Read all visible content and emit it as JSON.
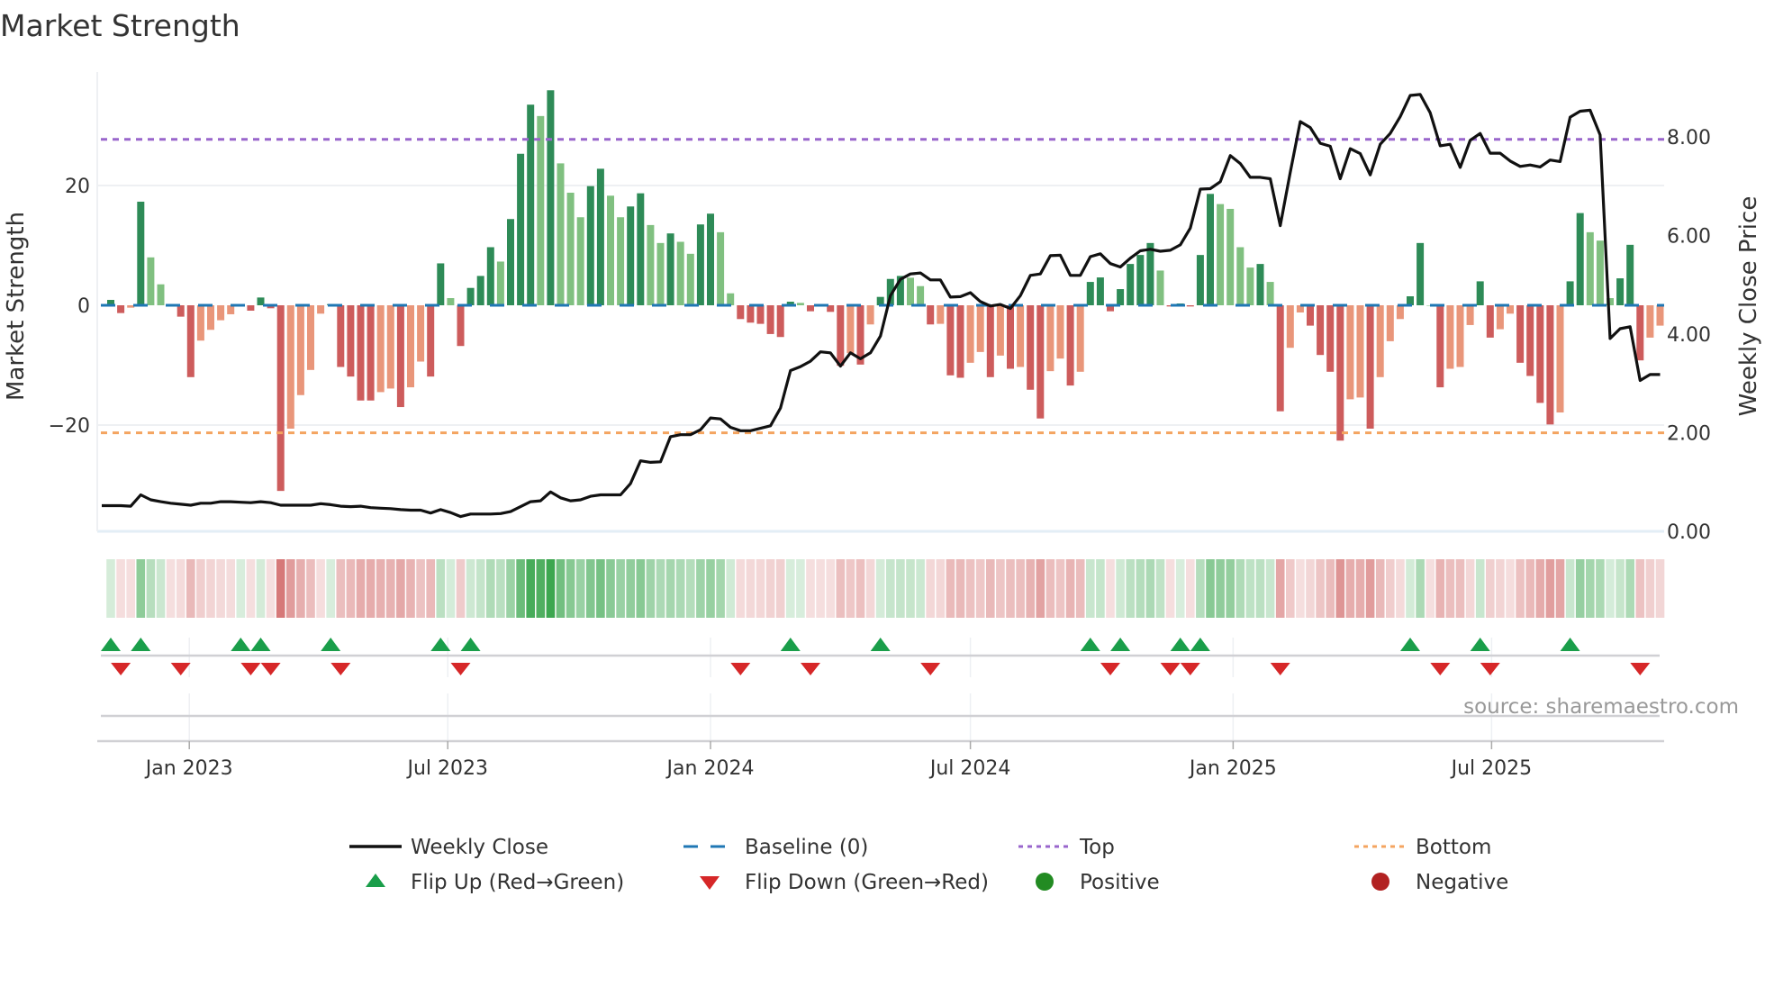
{
  "chart_data": {
    "type": "bar",
    "title": "Market Strength",
    "ylabel": "Market Strength",
    "y2label": "Weekly Close Price",
    "source": "source: sharemaestro.com",
    "start_week": "2022-11-07",
    "ylim": [
      -37.7,
      39
    ],
    "y2lim": [
      0,
      8.0
    ],
    "yticks": [
      {
        "v": 20,
        "label": "20"
      },
      {
        "v": 0,
        "label": "0"
      },
      {
        "v": -20,
        "label": "−20"
      }
    ],
    "y2ticks": [
      {
        "v": 0,
        "label": "0.00"
      },
      {
        "v": 2,
        "label": "2.00"
      },
      {
        "v": 4,
        "label": "4.00"
      },
      {
        "v": 6,
        "label": "6.00"
      },
      {
        "v": 8,
        "label": "8.00"
      }
    ],
    "xticks": [
      {
        "date": "2023-01-01",
        "label": "Jan 2023"
      },
      {
        "date": "2023-07-01",
        "label": "Jul 2023"
      },
      {
        "date": "2024-01-01",
        "label": "Jan 2024"
      },
      {
        "date": "2024-07-01",
        "label": "Jul 2024"
      },
      {
        "date": "2025-01-01",
        "label": "Jan 2025"
      },
      {
        "date": "2025-07-01",
        "label": "Jul 2025"
      }
    ],
    "top_level": 27.7,
    "bottom_level": -21.3,
    "strength": [
      0.9,
      -1.3,
      -0.4,
      17.3,
      8,
      3.5,
      0,
      -1.9,
      -12,
      -5.9,
      -4.1,
      -2.5,
      -1.5,
      0.2,
      -0.9,
      1.3,
      -0.5,
      -31,
      -20.6,
      -15,
      -10.8,
      -1.4,
      0.2,
      -10.3,
      -11.9,
      -15.9,
      -15.9,
      -14.5,
      -13.9,
      -17,
      -13.7,
      -9.4,
      -11.9,
      7,
      1.2,
      -6.8,
      2.9,
      4.9,
      9.7,
      7.3,
      14.4,
      25.3,
      33.5,
      31.6,
      35.9,
      23.7,
      18.8,
      14.7,
      19.9,
      22.8,
      18.3,
      14.7,
      16.5,
      18.7,
      13.4,
      10.4,
      12,
      10.6,
      8.6,
      13.5,
      15.3,
      12.2,
      2,
      -2.3,
      -2.9,
      -3.1,
      -4.8,
      -5.3,
      0.6,
      0.4,
      -1,
      0,
      -1.1,
      -10.1,
      -8,
      -9.9,
      -3.2,
      1.4,
      4.4,
      4.9,
      4.6,
      3.2,
      -3.2,
      -3.1,
      -11.7,
      -12.1,
      -9.6,
      -7.8,
      -12,
      -8.4,
      -10.6,
      -10.3,
      -14.1,
      -18.9,
      -11,
      -8.9,
      -13.4,
      -11.1,
      3.9,
      4.65,
      -1,
      2.7,
      6.9,
      8.4,
      10.4,
      5.8,
      -0.2,
      0.3,
      -0.2,
      8.4,
      18.6,
      16.9,
      16.1,
      9.7,
      6.3,
      6.9,
      3.9,
      -17.7,
      -7.1,
      -1.2,
      -3.4,
      -8.3,
      -11.1,
      -22.6,
      -15.7,
      -15.4,
      -20.6,
      -12,
      -6,
      -2.3,
      1.5,
      10.4,
      0,
      -13.7,
      -10.6,
      -10.3,
      -3.3,
      4,
      -5.4,
      -4,
      -1.4,
      -9.6,
      -11.8,
      -16.3,
      -19.9,
      -17.9,
      4,
      15.4,
      12.2,
      10.8,
      1.2,
      4.5,
      10.1,
      -9.2,
      -5.4,
      -3.4
    ],
    "weekly_close": [
      0.52,
      0.52,
      0.51,
      0.74,
      0.64,
      0.6,
      0.57,
      0.55,
      0.53,
      0.57,
      0.57,
      0.6,
      0.6,
      0.59,
      0.58,
      0.6,
      0.58,
      0.53,
      0.53,
      0.53,
      0.53,
      0.56,
      0.54,
      0.51,
      0.5,
      0.51,
      0.48,
      0.47,
      0.46,
      0.44,
      0.43,
      0.43,
      0.37,
      0.44,
      0.38,
      0.3,
      0.35,
      0.35,
      0.35,
      0.36,
      0.4,
      0.5,
      0.6,
      0.62,
      0.8,
      0.68,
      0.62,
      0.64,
      0.71,
      0.74,
      0.74,
      0.74,
      0.97,
      1.43,
      1.4,
      1.41,
      1.92,
      1.96,
      1.96,
      2.06,
      2.3,
      2.28,
      2.11,
      2.04,
      2.04,
      2.09,
      2.14,
      2.5,
      3.26,
      3.34,
      3.45,
      3.64,
      3.62,
      3.35,
      3.62,
      3.5,
      3.62,
      3.96,
      4.78,
      5.11,
      5.22,
      5.24,
      5.1,
      5.1,
      4.75,
      4.76,
      4.84,
      4.66,
      4.57,
      4.6,
      4.52,
      4.78,
      5.19,
      5.22,
      5.59,
      5.6,
      5.19,
      5.19,
      5.57,
      5.63,
      5.43,
      5.36,
      5.54,
      5.69,
      5.72,
      5.68,
      5.7,
      5.81,
      6.15,
      6.94,
      6.95,
      7.09,
      7.62,
      7.46,
      7.18,
      7.18,
      7.15,
      6.2,
      7.28,
      8.31,
      8.19,
      7.87,
      7.81,
      7.15,
      7.76,
      7.66,
      7.23,
      7.85,
      8.07,
      8.41,
      8.84,
      8.86,
      8.49,
      7.82,
      7.85,
      7.38,
      7.93,
      8.07,
      7.67,
      7.67,
      7.51,
      7.4,
      7.43,
      7.39,
      7.53,
      7.5,
      8.4,
      8.52,
      8.54,
      8.04,
      3.91,
      4.11,
      4.15,
      3.06,
      3.18,
      3.18
    ],
    "flip_up_weeks": [
      1,
      4,
      14,
      16,
      23,
      34,
      37,
      69,
      78,
      99,
      102,
      108,
      110,
      131,
      138,
      147
    ],
    "flip_down_weeks": [
      2,
      8,
      15,
      17,
      24,
      36,
      64,
      71,
      83,
      101,
      107,
      109,
      118,
      134,
      139,
      154
    ],
    "legend": [
      {
        "label": "Weekly Close",
        "kind": "line"
      },
      {
        "label": "Baseline (0)",
        "kind": "dash"
      },
      {
        "label": "Top",
        "kind": "dot-top"
      },
      {
        "label": "Bottom",
        "kind": "dot-bottom"
      },
      {
        "label": "Flip Up (Red→Green)",
        "kind": "up"
      },
      {
        "label": "Flip Down (Green→Red)",
        "kind": "down"
      },
      {
        "label": "Positive",
        "kind": "pos"
      },
      {
        "label": "Negative",
        "kind": "neg"
      }
    ],
    "legend_placement": "bottom",
    "colors": {
      "rise_pos": "#2e8b57",
      "fall_pos": "#80c080",
      "fall_neg": "#cd5c5c",
      "rise_neg": "#e9967a",
      "close": "#111111",
      "baseline": "#1f77b4",
      "top": "#9966cc",
      "bottom": "#f4a460",
      "flip_up": "#1a9e4a",
      "flip_down": "#d62728",
      "positive": "#228b22",
      "negative": "#b22222"
    }
  }
}
